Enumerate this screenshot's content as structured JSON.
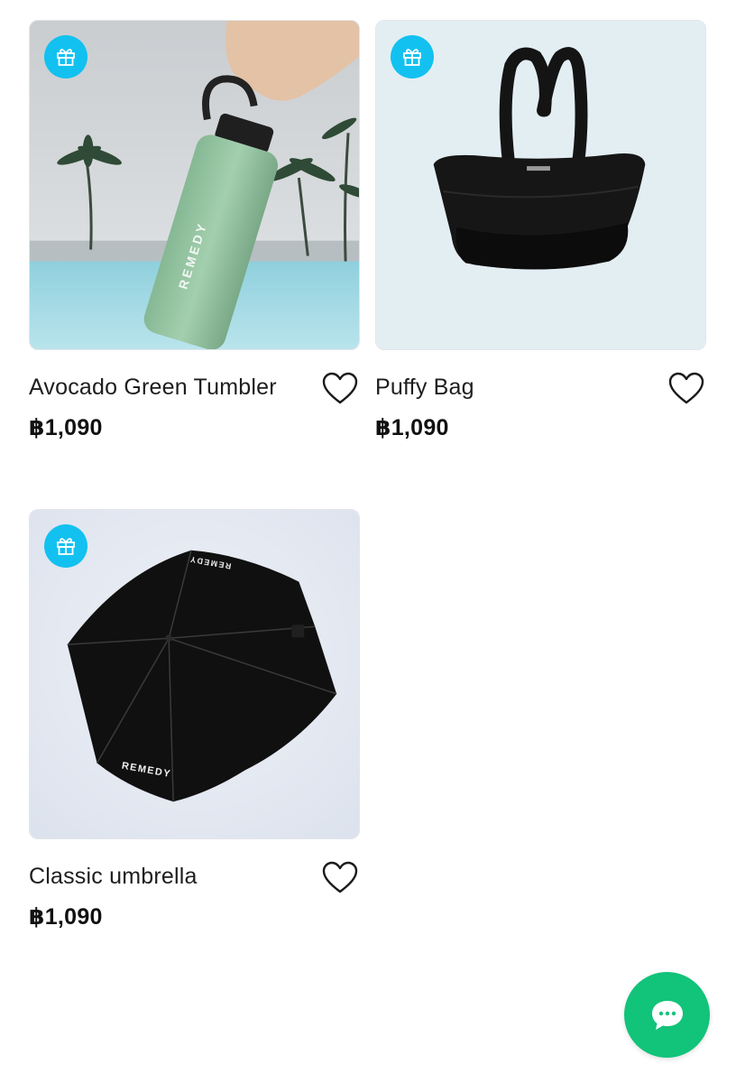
{
  "products": [
    {
      "title": "Avocado Green Tumbler",
      "price": "฿1,090",
      "badge_icon": "gift-icon",
      "image": "green-tumbler-photo",
      "image_text": "REMEDY"
    },
    {
      "title": "Puffy Bag",
      "price": "฿1,090",
      "badge_icon": "gift-icon",
      "image": "black-puffy-bag-photo"
    },
    {
      "title": "Classic umbrella",
      "price": "฿1,090",
      "badge_icon": "gift-icon",
      "image": "black-umbrella-photo",
      "image_text": "REMEDY"
    }
  ],
  "chat": {
    "icon": "chat-bubble-icon",
    "color": "#12c37a"
  },
  "colors": {
    "badge": "#12c1f0",
    "text": "#1e1e1e"
  }
}
